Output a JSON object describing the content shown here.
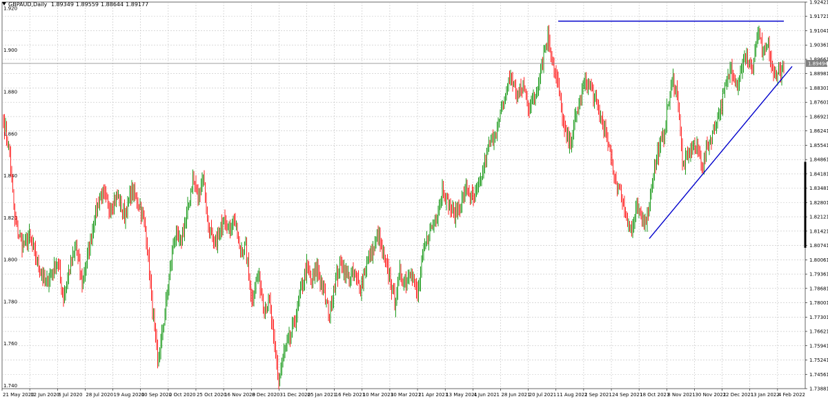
{
  "header": {
    "symbol": "GBPAUD,Daily",
    "open": "1.89349",
    "high": "1.89559",
    "low": "1.88644",
    "close": "1.89177"
  },
  "colors": {
    "bull": "#1a9a1a",
    "bear": "#ff2020",
    "grid": "#c0c0c0",
    "trendline": "#0000cc",
    "bid_line": "#808080",
    "bid_tag_bg": "#808080",
    "bid_tag_text": "#ffffff",
    "background": "#ffffff"
  },
  "chart_data": {
    "type": "candlestick",
    "grid": true,
    "ylim": [
      1.7398,
      1.9242
    ],
    "left_axis_labels": [
      "1.920",
      "1.900",
      "1.880",
      "1.860",
      "1.840",
      "1.820",
      "1.800",
      "1.780",
      "1.760",
      "1.740"
    ],
    "y_ticks": [
      "1.92421",
      "1.91721",
      "1.91041",
      "1.90361",
      "1.89661",
      "1.88981",
      "1.88301",
      "1.87601",
      "1.86921",
      "1.86241",
      "1.85541",
      "1.84861",
      "1.84181",
      "1.83481",
      "1.82801",
      "1.82121",
      "1.81421",
      "1.80741",
      "1.80061",
      "1.79361",
      "1.78681",
      "1.78001",
      "1.77301",
      "1.76621",
      "1.75941",
      "1.75241",
      "1.74561",
      "1.73881"
    ],
    "current_price": "1.89494",
    "x_labels": [
      "21 May 2020",
      "12 Jun 2020",
      "6 Jul 2020",
      "28 Jul 2020",
      "19 Aug 2020",
      "10 Sep 2020",
      "2 Oct 2020",
      "25 Oct 2020",
      "16 Nov 2020",
      "8 Dec 2020",
      "31 Dec 2020",
      "25 Jan 2021",
      "16 Feb 2021",
      "10 Mar 2021",
      "30 Mar 2021",
      "21 Apr 2021",
      "13 May 2021",
      "4 Jun 2021",
      "28 Jun 2021",
      "20 Jul 2021",
      "11 Aug 2021",
      "2 Sep 2021",
      "24 Sep 2021",
      "18 Oct 2021",
      "8 Nov 2021",
      "30 Nov 2021",
      "22 Dec 2021",
      "13 Jan 2022",
      "4 Feb 2022"
    ],
    "anchors": [
      [
        0,
        1.868
      ],
      [
        6,
        1.852
      ],
      [
        11,
        1.82
      ],
      [
        18,
        1.808
      ],
      [
        25,
        1.812
      ],
      [
        33,
        1.8
      ],
      [
        40,
        1.79
      ],
      [
        45,
        1.793
      ],
      [
        52,
        1.8
      ],
      [
        58,
        1.784
      ],
      [
        64,
        1.797
      ],
      [
        70,
        1.807
      ],
      [
        76,
        1.79
      ],
      [
        83,
        1.807
      ],
      [
        88,
        1.822
      ],
      [
        95,
        1.834
      ],
      [
        102,
        1.826
      ],
      [
        110,
        1.832
      ],
      [
        117,
        1.822
      ],
      [
        124,
        1.834
      ],
      [
        132,
        1.827
      ],
      [
        138,
        1.813
      ],
      [
        143,
        1.783
      ],
      [
        149,
        1.752
      ],
      [
        154,
        1.768
      ],
      [
        160,
        1.792
      ],
      [
        165,
        1.812
      ],
      [
        171,
        1.809
      ],
      [
        177,
        1.822
      ],
      [
        183,
        1.84
      ],
      [
        188,
        1.831
      ],
      [
        193,
        1.842
      ],
      [
        197,
        1.82
      ],
      [
        203,
        1.808
      ],
      [
        208,
        1.812
      ],
      [
        213,
        1.823
      ],
      [
        218,
        1.815
      ],
      [
        223,
        1.822
      ],
      [
        228,
        1.806
      ],
      [
        234,
        1.807
      ],
      [
        240,
        1.782
      ],
      [
        246,
        1.795
      ],
      [
        252,
        1.778
      ],
      [
        257,
        1.78
      ],
      [
        261,
        1.762
      ],
      [
        266,
        1.744
      ],
      [
        271,
        1.757
      ],
      [
        277,
        1.764
      ],
      [
        283,
        1.775
      ],
      [
        288,
        1.788
      ],
      [
        293,
        1.798
      ],
      [
        298,
        1.79
      ],
      [
        303,
        1.797
      ],
      [
        309,
        1.786
      ],
      [
        315,
        1.775
      ],
      [
        321,
        1.792
      ],
      [
        327,
        1.799
      ],
      [
        333,
        1.793
      ],
      [
        339,
        1.794
      ],
      [
        345,
        1.788
      ],
      [
        351,
        1.8
      ],
      [
        357,
        1.806
      ],
      [
        362,
        1.813
      ],
      [
        368,
        1.801
      ],
      [
        373,
        1.793
      ],
      [
        378,
        1.781
      ],
      [
        383,
        1.795
      ],
      [
        389,
        1.791
      ],
      [
        394,
        1.797
      ],
      [
        400,
        1.783
      ],
      [
        406,
        1.805
      ],
      [
        412,
        1.815
      ],
      [
        418,
        1.821
      ],
      [
        424,
        1.835
      ],
      [
        430,
        1.828
      ],
      [
        436,
        1.822
      ],
      [
        442,
        1.829
      ],
      [
        448,
        1.836
      ],
      [
        454,
        1.828
      ],
      [
        460,
        1.837
      ],
      [
        466,
        1.85
      ],
      [
        472,
        1.859
      ],
      [
        478,
        1.865
      ],
      [
        484,
        1.878
      ],
      [
        490,
        1.889
      ],
      [
        496,
        1.88
      ],
      [
        502,
        1.884
      ],
      [
        508,
        1.874
      ],
      [
        514,
        1.88
      ],
      [
        520,
        1.895
      ],
      [
        526,
        1.908
      ],
      [
        532,
        1.893
      ],
      [
        537,
        1.881
      ],
      [
        542,
        1.862
      ],
      [
        547,
        1.856
      ],
      [
        552,
        1.867
      ],
      [
        557,
        1.877
      ],
      [
        563,
        1.887
      ],
      [
        569,
        1.882
      ],
      [
        575,
        1.872
      ],
      [
        580,
        1.865
      ],
      [
        586,
        1.852
      ],
      [
        591,
        1.84
      ],
      [
        597,
        1.832
      ],
      [
        602,
        1.822
      ],
      [
        607,
        1.815
      ],
      [
        612,
        1.826
      ],
      [
        617,
        1.819
      ],
      [
        622,
        1.822
      ],
      [
        627,
        1.84
      ],
      [
        632,
        1.852
      ],
      [
        637,
        1.858
      ],
      [
        642,
        1.875
      ],
      [
        647,
        1.887
      ],
      [
        652,
        1.878
      ],
      [
        656,
        1.846
      ],
      [
        661,
        1.85
      ],
      [
        666,
        1.856
      ],
      [
        671,
        1.853
      ],
      [
        676,
        1.847
      ],
      [
        681,
        1.856
      ],
      [
        686,
        1.863
      ],
      [
        691,
        1.871
      ],
      [
        697,
        1.882
      ],
      [
        703,
        1.893
      ],
      [
        709,
        1.885
      ],
      [
        714,
        1.895
      ],
      [
        719,
        1.898
      ],
      [
        724,
        1.892
      ],
      [
        729,
        1.91
      ],
      [
        734,
        1.899
      ],
      [
        739,
        1.903
      ],
      [
        744,
        1.888
      ],
      [
        749,
        1.892
      ],
      [
        754,
        1.891
      ]
    ],
    "trendlines": [
      {
        "x": [
          536,
          754
        ],
        "y": [
          1.9151,
          1.9151
        ]
      },
      {
        "x": [
          624,
          762
        ],
        "y": [
          1.8114,
          1.8935
        ]
      }
    ]
  }
}
